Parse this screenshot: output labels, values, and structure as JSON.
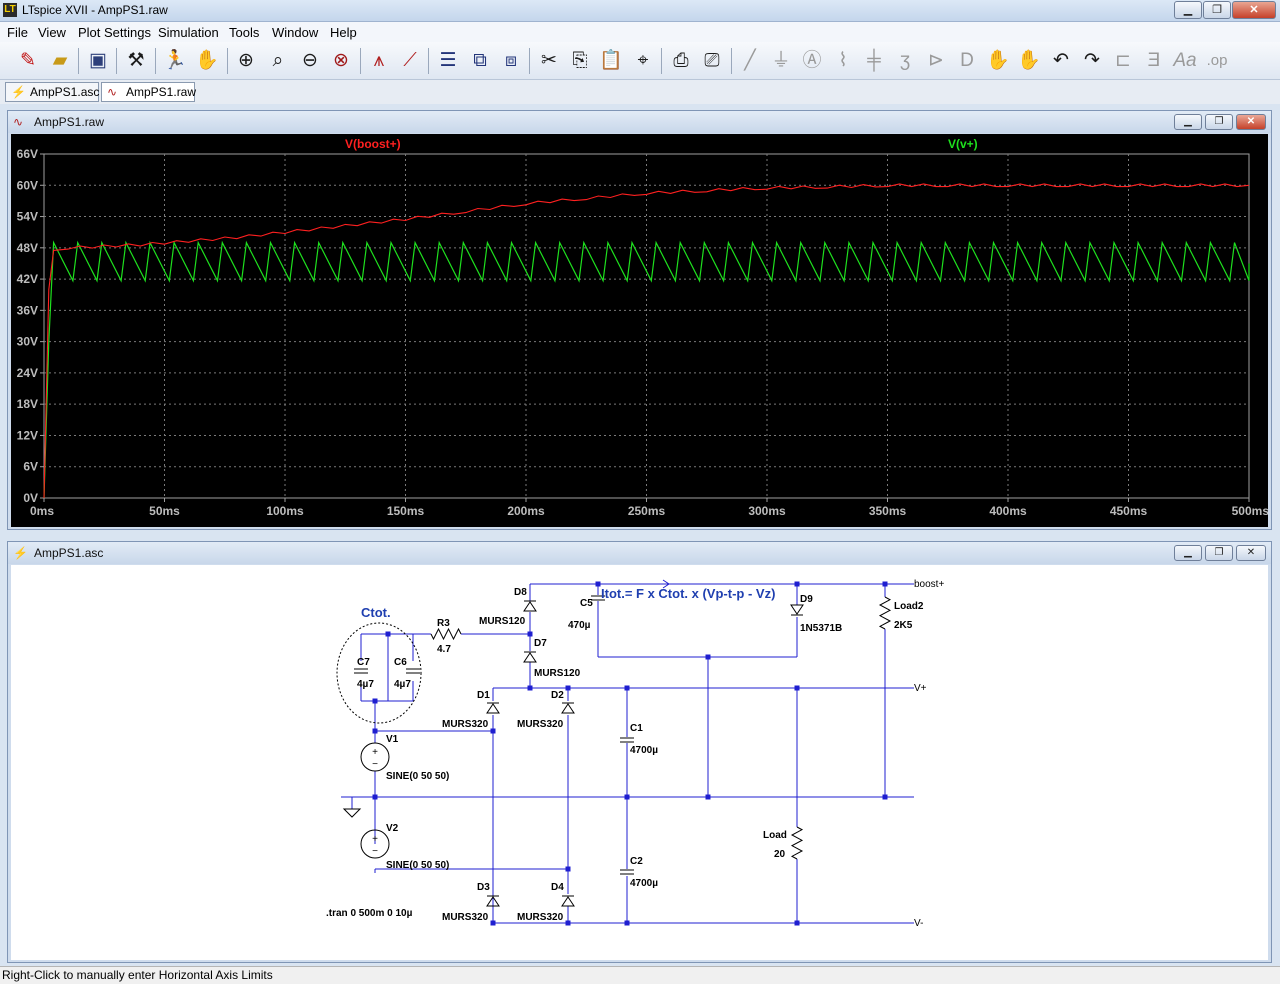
{
  "window": {
    "title": "LTspice XVII - AmpPS1.raw",
    "app_icon": "LT"
  },
  "menu": [
    "File",
    "View",
    "Plot Settings",
    "Simulation",
    "Tools",
    "Window",
    "Help"
  ],
  "doc_tabs": [
    {
      "label": "AmpPS1.asc",
      "icon": "schematic-icon",
      "active": false
    },
    {
      "label": "AmpPS1.raw",
      "icon": "waveform-icon",
      "active": true
    }
  ],
  "waveform_window": {
    "title": "AmpPS1.raw"
  },
  "schematic_window": {
    "title": "AmpPS1.asc"
  },
  "status": "Right-Click to manually enter Horizontal Axis Limits",
  "colors": {
    "boost": "#ff2020",
    "vplus": "#1ee01e",
    "plot_bg": "#000000",
    "wire": "#1f1fd0",
    "junction": "#1f1fd0"
  },
  "chart_data": {
    "type": "line",
    "xlabel": "",
    "ylabel": "",
    "x_unit": "ms",
    "xlim": [
      0,
      500
    ],
    "ylim": [
      0,
      66
    ],
    "x_ticks": [
      "0ms",
      "50ms",
      "100ms",
      "150ms",
      "200ms",
      "250ms",
      "300ms",
      "350ms",
      "400ms",
      "450ms",
      "500ms"
    ],
    "y_ticks": [
      "0V",
      "6V",
      "12V",
      "18V",
      "24V",
      "30V",
      "36V",
      "42V",
      "48V",
      "54V",
      "60V",
      "66V"
    ],
    "grid": true,
    "series": [
      {
        "name": "V(boost+)",
        "color": "#ff2020",
        "x": [
          0,
          2,
          4,
          10,
          20,
          40,
          60,
          80,
          100,
          120,
          150,
          175,
          200,
          225,
          250,
          275,
          300,
          325,
          350,
          375,
          400,
          425,
          450,
          475,
          500
        ],
        "y": [
          0,
          40,
          47.5,
          48,
          48.2,
          48.6,
          49.3,
          50,
          51,
          52,
          53.5,
          55,
          56.5,
          57.5,
          58.5,
          59,
          59.5,
          59.7,
          60,
          60,
          60,
          60,
          60,
          60,
          60
        ]
      },
      {
        "name": "V(v+)",
        "color": "#1ee01e",
        "ripple": {
          "period_ms": 10,
          "min": 41.7,
          "max": 49
        },
        "x": [
          0,
          2,
          4,
          500
        ],
        "y": [
          0,
          30,
          49,
          45
        ]
      }
    ]
  },
  "schematic": {
    "texts": [
      {
        "id": "ctot-label",
        "text": "Ctot."
      },
      {
        "id": "formula",
        "text": "Itot.= F x Ctot. x (Vp-t-p - Vz)"
      },
      {
        "id": "r3-name",
        "text": "R3"
      },
      {
        "id": "r3-val",
        "text": "4.7"
      },
      {
        "id": "c7-name",
        "text": "C7"
      },
      {
        "id": "c7-val",
        "text": "4µ7"
      },
      {
        "id": "c6-name",
        "text": "C6"
      },
      {
        "id": "c6-val",
        "text": "4µ7"
      },
      {
        "id": "d8-name",
        "text": "D8"
      },
      {
        "id": "d8-val",
        "text": "MURS120"
      },
      {
        "id": "d7-name",
        "text": "D7"
      },
      {
        "id": "d7-val",
        "text": "MURS120"
      },
      {
        "id": "c5-name",
        "text": "C5"
      },
      {
        "id": "c5-val",
        "text": "470µ"
      },
      {
        "id": "d9-name",
        "text": "D9"
      },
      {
        "id": "d9-val",
        "text": "1N5371B"
      },
      {
        "id": "load2-name",
        "text": "Load2"
      },
      {
        "id": "load2-val",
        "text": "2K5"
      },
      {
        "id": "boost-net",
        "text": "boost+"
      },
      {
        "id": "vplus-net",
        "text": "V+"
      },
      {
        "id": "vminus-net",
        "text": "V-"
      },
      {
        "id": "d1-name",
        "text": "D1"
      },
      {
        "id": "d1-val",
        "text": "MURS320"
      },
      {
        "id": "d2-name",
        "text": "D2"
      },
      {
        "id": "d2-val",
        "text": "MURS320"
      },
      {
        "id": "d3-name",
        "text": "D3"
      },
      {
        "id": "d3-val",
        "text": "MURS320"
      },
      {
        "id": "d4-name",
        "text": "D4"
      },
      {
        "id": "d4-val",
        "text": "MURS320"
      },
      {
        "id": "c1-name",
        "text": "C1"
      },
      {
        "id": "c1-val",
        "text": "4700µ"
      },
      {
        "id": "c2-name",
        "text": "C2"
      },
      {
        "id": "c2-val",
        "text": "4700µ"
      },
      {
        "id": "v1-name",
        "text": "V1"
      },
      {
        "id": "v1-val",
        "text": "SINE(0 50 50)"
      },
      {
        "id": "v2-name",
        "text": "V2"
      },
      {
        "id": "v2-val",
        "text": "SINE(0 50 50)"
      },
      {
        "id": "load-name",
        "text": "Load"
      },
      {
        "id": "load-val",
        "text": "20"
      },
      {
        "id": "tran",
        "text": ".tran 0 500m 0 10µ"
      }
    ]
  }
}
